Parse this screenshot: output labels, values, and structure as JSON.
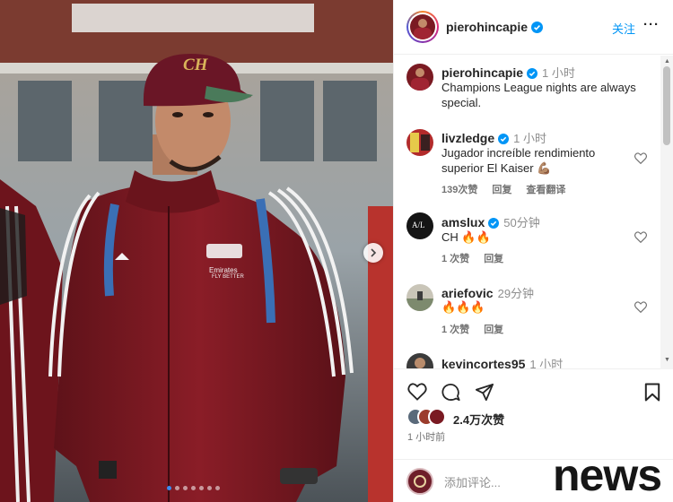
{
  "colors": {
    "link": "#0095f6",
    "verified": "#0095f6",
    "jacket": "#7a1a22",
    "cap": "#6a1626"
  },
  "photo": {
    "jacket_crest_text": "Emirates",
    "jacket_crest_sub": "FLY BETTER",
    "cap_logo": "CH",
    "carousel_dots": 7,
    "active_dot": 0,
    "next_icon": "chevron-right-icon"
  },
  "header": {
    "username": "pierohincapie",
    "follow_label": "关注",
    "more_label": "···"
  },
  "caption": {
    "username": "pierohincapie",
    "time": "1 小时",
    "text": "Champions League nights are always special."
  },
  "comments": [
    {
      "username": "livzledge",
      "verified": true,
      "time": "1 小时",
      "text": "Jugador increíble rendimiento superior El Kaiser 💪🏽",
      "likes": "139次赞",
      "reply": "回复",
      "translate": "查看翻译"
    },
    {
      "username": "amslux",
      "verified": true,
      "time": "50分钟",
      "text": "CH 🔥🔥",
      "likes": "1 次赞",
      "reply": "回复"
    },
    {
      "username": "ariefovic",
      "verified": false,
      "time": "29分钟",
      "text": "🔥🔥🔥",
      "likes": "1 次赞",
      "reply": "回复"
    },
    {
      "username": "kevincortes95",
      "verified": false,
      "time": "1 小时",
      "text": ""
    }
  ],
  "actions": {
    "icons": [
      "heart-icon",
      "comment-icon",
      "share-icon",
      "bookmark-icon"
    ],
    "likes_count": "2.4万次赞",
    "post_time": "1 小时前"
  },
  "add_comment": {
    "placeholder": "添加评论..."
  },
  "watermark": "news"
}
